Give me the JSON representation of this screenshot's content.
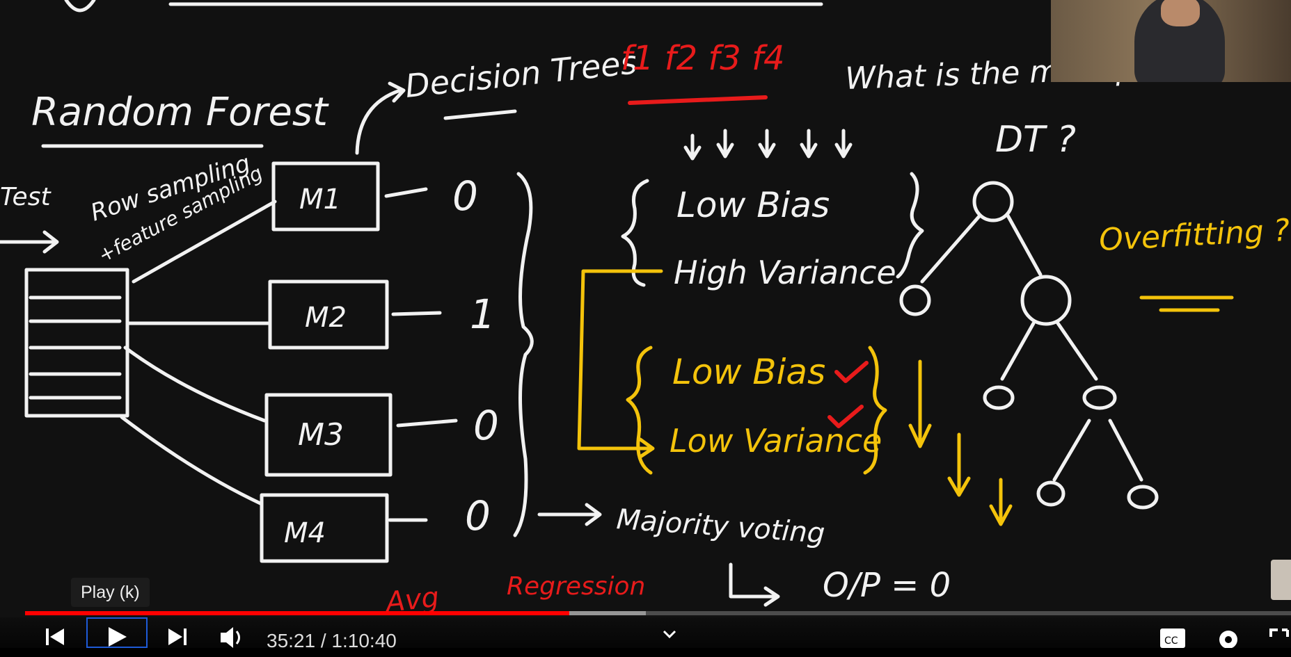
{
  "board": {
    "title": "Random Forest",
    "input_label": "Test",
    "sampling_label": "Row sampling",
    "sampling_label2": "+feature sampling",
    "decision_trees": "Decision Trees",
    "features": "f1  f2  f3  f4",
    "models": [
      "M1",
      "M2",
      "M3",
      "M4"
    ],
    "outputs": [
      "0",
      "1",
      "0",
      "0"
    ],
    "majority_voting": "Majority voting",
    "output_label": "O/P = 0",
    "avg_label": "Avg",
    "regression_label": "Regression",
    "question_line1": "What is the main problem of",
    "question_line2": "DT ?",
    "low_bias_1": "Low    Bias",
    "high_variance": "High    Variance",
    "low_bias_2": "Low    Bias",
    "low_variance": "Low    Variance",
    "overfitting": "Overfitting ??",
    "colors": {
      "white": "#f2f2f2",
      "yellow": "#f4c30b",
      "red": "#e81b1b"
    }
  },
  "player": {
    "tooltip": "Play (k)",
    "current_time": "35:21",
    "separator": " / ",
    "duration": "1:10:40",
    "progress_fraction": 0.5,
    "buffered_fraction": 0.455,
    "icons": [
      "previous-icon",
      "play-icon",
      "next-icon",
      "volume-icon",
      "chevron-down-icon",
      "captions-icon",
      "settings-icon",
      "fullscreen-icon"
    ]
  }
}
